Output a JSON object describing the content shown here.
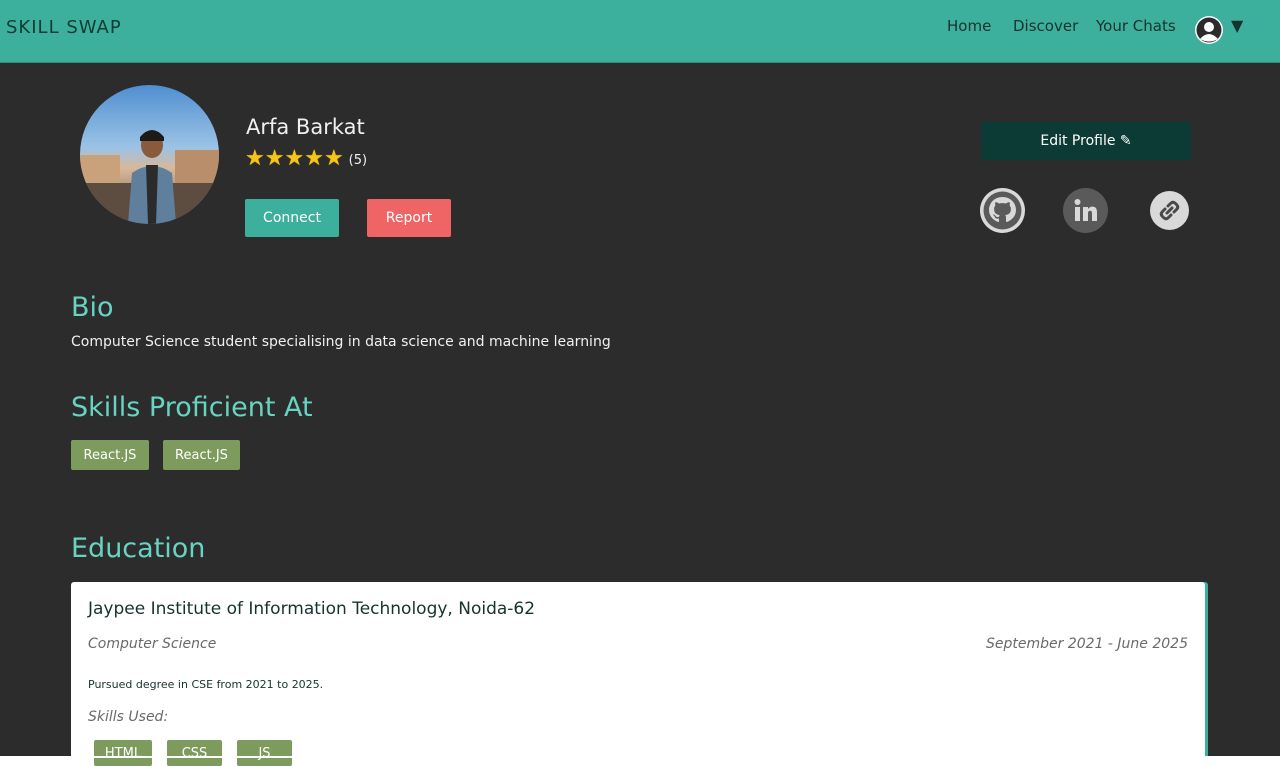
{
  "navbar": {
    "brand": "SKILL SWAP",
    "links": [
      "Home",
      "Discover",
      "Your Chats"
    ],
    "caret": "▼"
  },
  "profile": {
    "name": "Arfa Barkat",
    "rating": 5,
    "rating_count": "(5)",
    "connect_label": "Connect",
    "report_label": "Report",
    "edit_label": "Edit Profile ✎",
    "socials": [
      "github-icon",
      "linkedin-icon",
      "link-icon"
    ]
  },
  "bio": {
    "heading": "Bio",
    "text": "Computer Science student specialising in data science and machine learning"
  },
  "skills": {
    "heading": "Skills Proficient At",
    "items": [
      "React.JS",
      "React.JS"
    ]
  },
  "education": {
    "heading": "Education",
    "entries": [
      {
        "institution": "Jaypee Institute of Information Technology, Noida-62",
        "field": "Computer Science",
        "dates": "September 2021 - June 2025",
        "description": "Pursued degree in CSE from 2021 to 2025.",
        "skills_label": "Skills Used:",
        "skills": [
          "HTML",
          "CSS",
          "JS"
        ]
      }
    ]
  },
  "colors": {
    "navbar": "#3db09d",
    "background": "#2c2c2c",
    "accent_heading": "#67d3c1",
    "report": "#ef6464",
    "edit": "#0b3b34",
    "skill_tag": "#7d9b5d"
  }
}
